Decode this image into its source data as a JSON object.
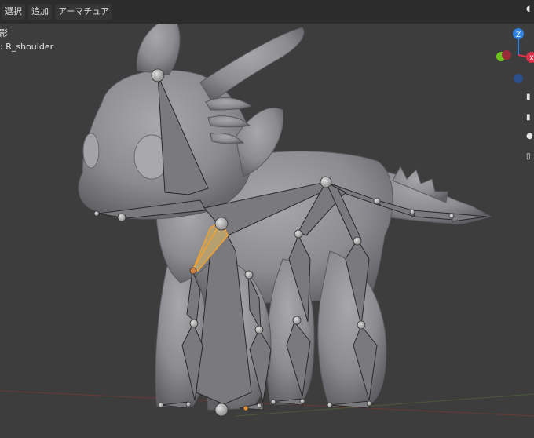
{
  "header": {
    "menu": [
      {
        "label": "選択"
      },
      {
        "label": "追加"
      },
      {
        "label": "アーマチュア"
      }
    ]
  },
  "overlay": {
    "mode_partial": "影",
    "active_bone_prefix": ":",
    "active_bone_name": "R_shoulder"
  },
  "gizmo": {
    "z_label": "Z",
    "x_label": "X",
    "colors": {
      "z": "#2f82e0",
      "x": "#d9344a",
      "y": "#6fc41f"
    }
  },
  "scene": {
    "colors": {
      "background": "#3d3d3d",
      "mesh": "#8e8e92",
      "bone_fill": "#7a7a7e",
      "bone_edge": "#2a2a2a",
      "selected_bone": "#f0a030"
    }
  }
}
